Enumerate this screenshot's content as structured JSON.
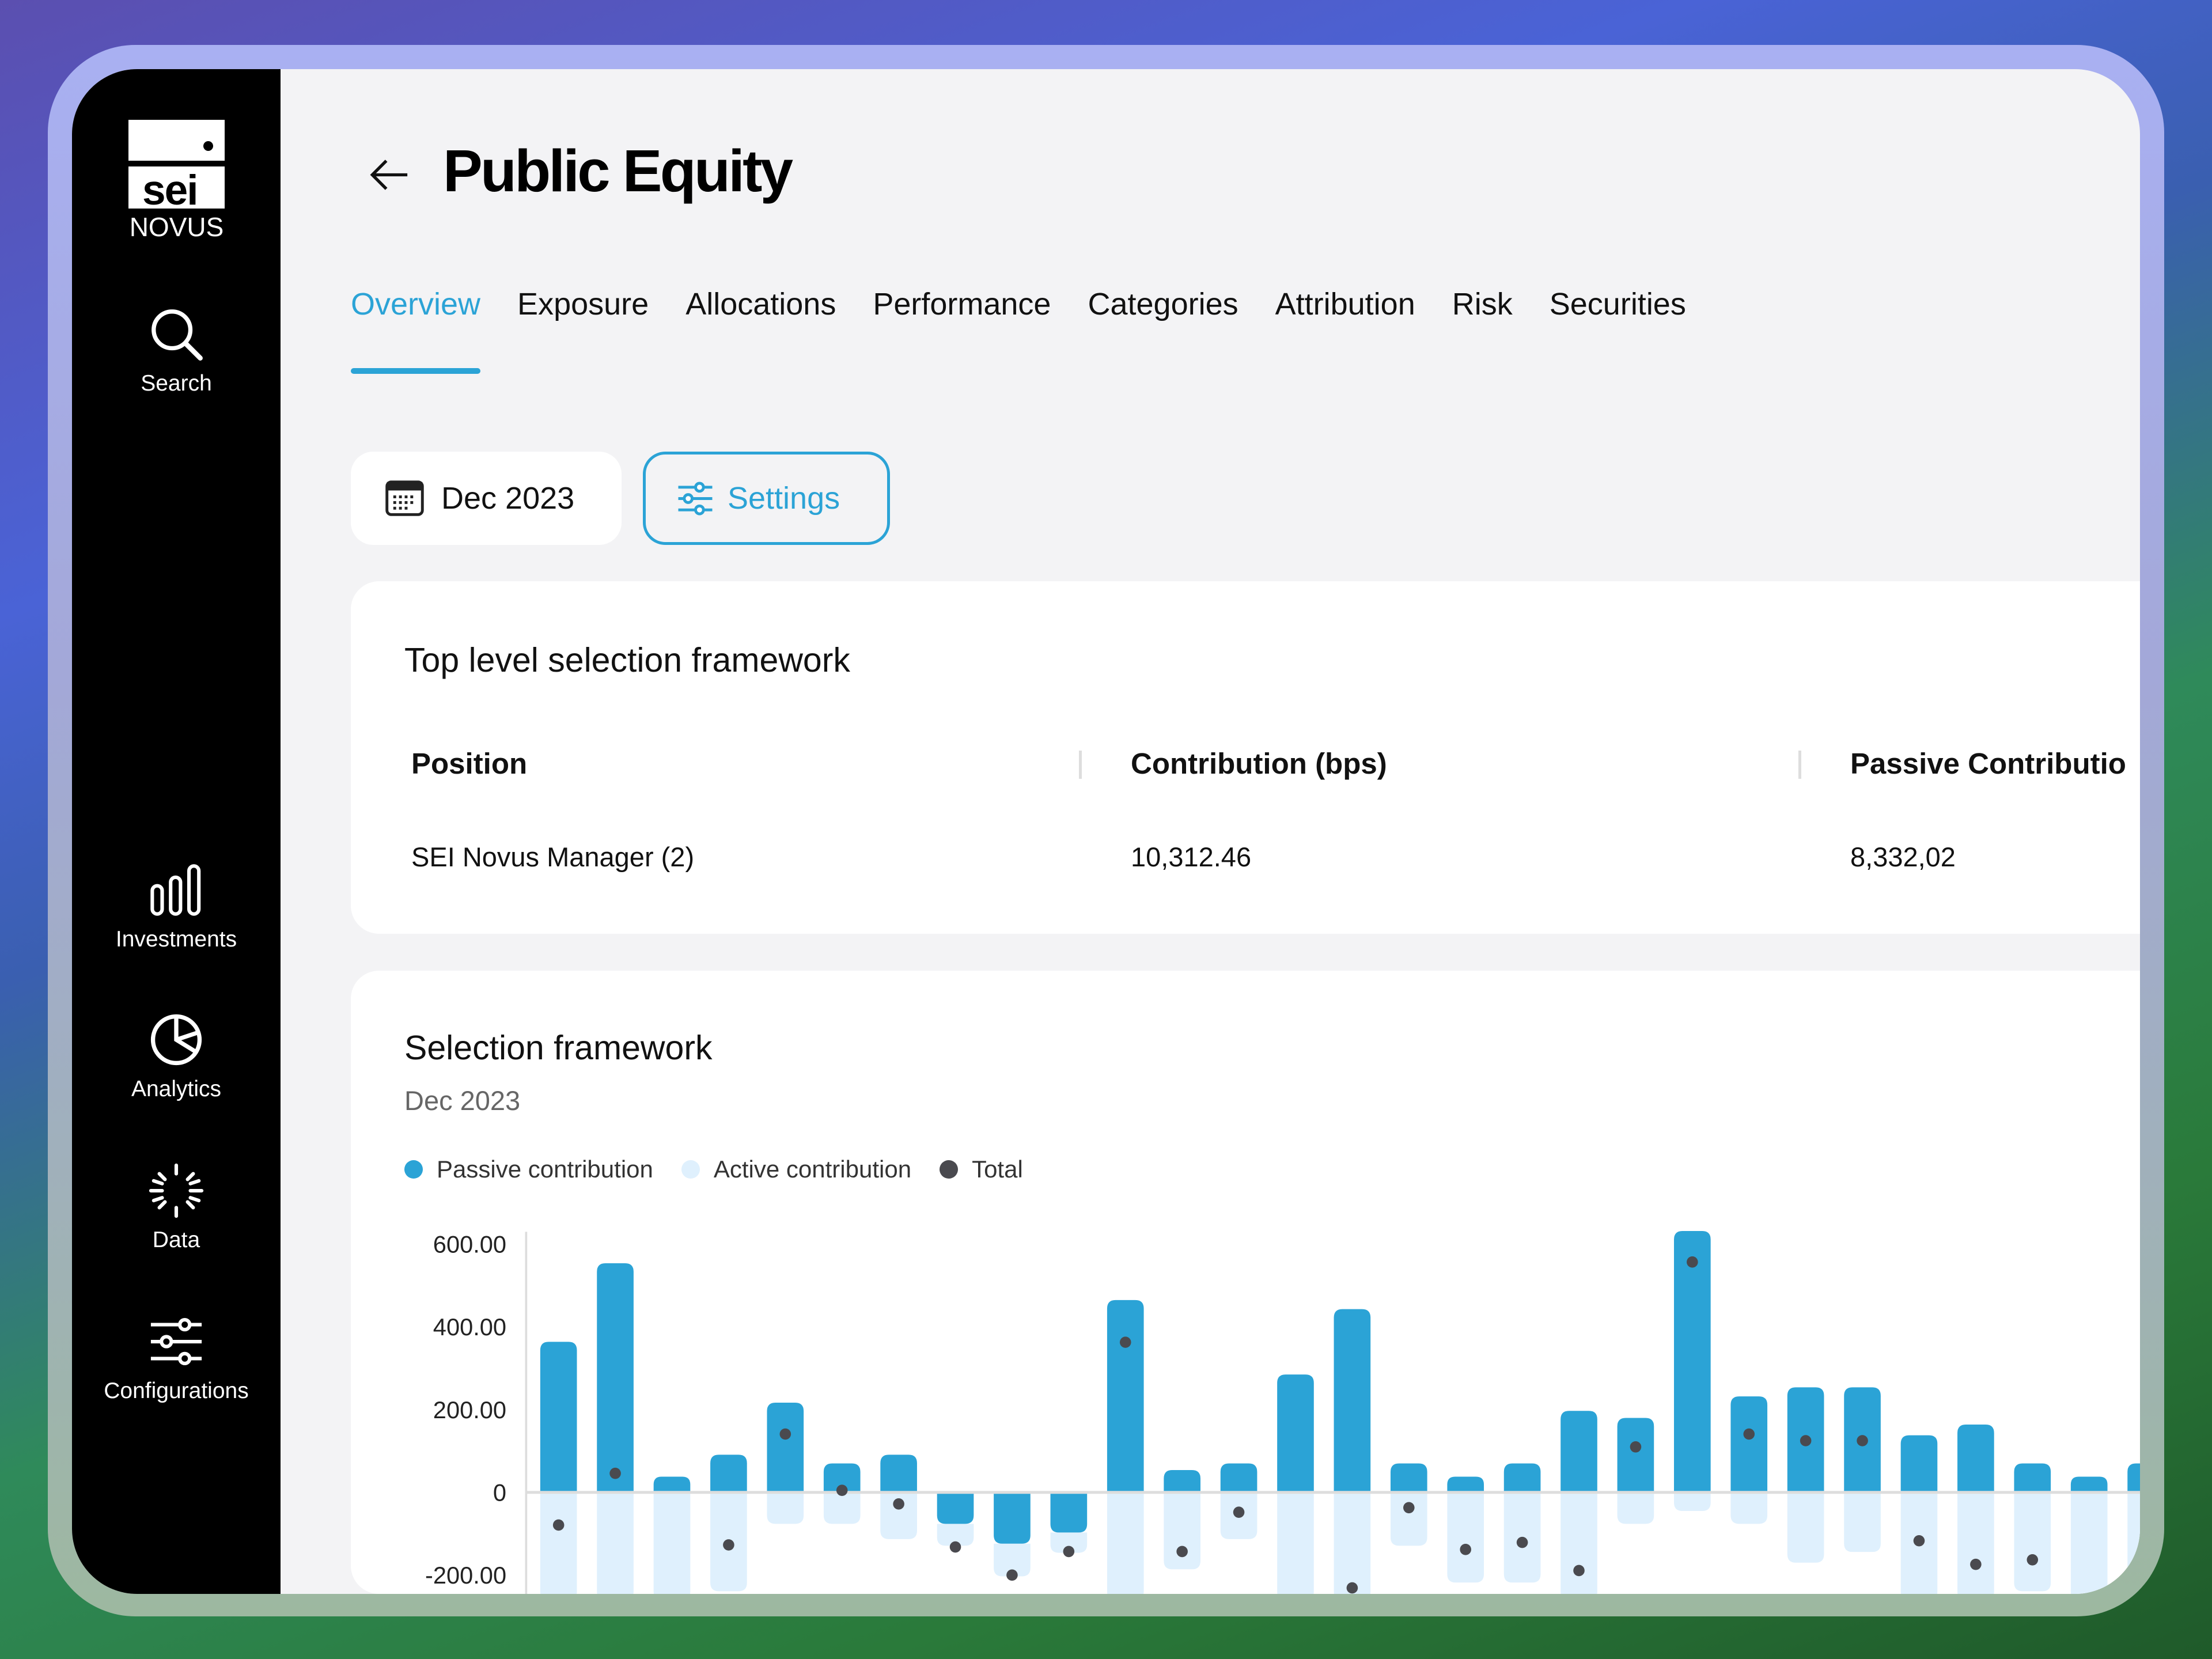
{
  "sidebar": {
    "logo": {
      "mark": "sei",
      "sub": "NOVUS"
    },
    "items": [
      {
        "label": "Search",
        "icon": "search-icon"
      },
      {
        "label": "Investments",
        "icon": "bar-chart-icon"
      },
      {
        "label": "Analytics",
        "icon": "pie-chart-icon"
      },
      {
        "label": "Data",
        "icon": "loader-icon"
      },
      {
        "label": "Configurations",
        "icon": "sliders-icon"
      }
    ]
  },
  "header": {
    "title": "Public Equity",
    "back_icon": "arrow-left-icon"
  },
  "tabs": [
    {
      "label": "Overview",
      "active": true
    },
    {
      "label": "Exposure"
    },
    {
      "label": "Allocations"
    },
    {
      "label": "Performance"
    },
    {
      "label": "Categories"
    },
    {
      "label": "Attribution"
    },
    {
      "label": "Risk"
    },
    {
      "label": "Securities"
    }
  ],
  "toolbar": {
    "date_label": "Dec 2023",
    "settings_label": "Settings"
  },
  "top_level": {
    "title": "Top level selection framework",
    "columns": [
      "Position",
      "Contribution (bps)",
      "Passive Contributio"
    ],
    "rows": [
      [
        "SEI Novus Manager (2)",
        "10,312.46",
        "8,332,02"
      ]
    ]
  },
  "selection": {
    "title": "Selection framework",
    "subtitle": "Dec 2023",
    "legend": [
      {
        "label": "Passive contribution",
        "color": "#2ba3d6"
      },
      {
        "label": "Active contribution",
        "color": "#dff0fd"
      },
      {
        "label": "Total",
        "color": "#4a4a4f"
      }
    ]
  },
  "colors": {
    "accent": "#2ba3d6",
    "active_bar": "#dff0fd",
    "total_dot": "#4a4a4f",
    "sidebar": "#000000"
  },
  "chart_data": {
    "type": "bar",
    "stacked": "diverging",
    "ylim": [
      -250,
      630
    ],
    "yticks": [
      "600.00",
      "400.00",
      "200.00",
      "0",
      "-200.00"
    ],
    "ytick_values": [
      600,
      400,
      200,
      0,
      -200
    ],
    "grid": false,
    "legend_placement": "top-left",
    "series": [
      {
        "name": "Passive contribution",
        "values": [
          364,
          554,
          38,
          91,
          217,
          70,
          91,
          -76,
          -124,
          -97,
          465,
          54,
          70,
          285,
          443,
          70,
          38,
          70,
          197,
          180,
          632,
          232,
          254,
          254,
          138,
          164,
          70,
          38,
          70
        ]
      },
      {
        "name": "Active contribution",
        "values": [
          -260,
          -260,
          -260,
          -239,
          -76,
          -76,
          -113,
          -53,
          -79,
          -49,
          -260,
          -186,
          -113,
          -260,
          -260,
          -129,
          -218,
          -218,
          -260,
          -76,
          -45,
          -76,
          -170,
          -144,
          -260,
          -260,
          -239,
          -260,
          -260
        ]
      },
      {
        "name": "Total",
        "values": [
          -79,
          46,
          null,
          -127,
          141,
          5,
          -28,
          -132,
          -200,
          -143,
          363,
          -143,
          -48,
          null,
          -231,
          -37,
          -138,
          -121,
          -189,
          110,
          557,
          141,
          125,
          125,
          -117,
          -174,
          -163,
          null,
          null
        ]
      }
    ]
  }
}
